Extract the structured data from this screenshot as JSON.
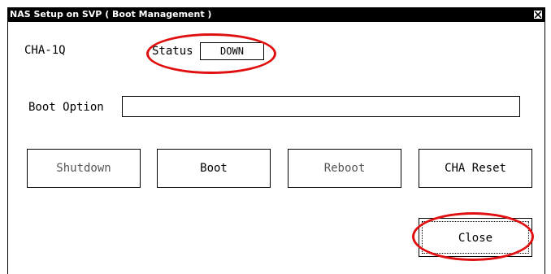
{
  "window": {
    "title": "NAS Setup on SVP ( Boot Management )"
  },
  "cha": {
    "id_label": "CHA-1Q",
    "status_label": "Status",
    "status_value": "DOWN"
  },
  "boot_option": {
    "label": "Boot Option",
    "value": ""
  },
  "buttons": {
    "shutdown": "Shutdown",
    "boot": "Boot",
    "reboot": "Reboot",
    "cha_reset": "CHA Reset",
    "close": "Close"
  },
  "colors": {
    "annotation_circle": "#e01010",
    "titlebar_bg": "#000000"
  },
  "icons": {
    "window_close": "close-icon"
  }
}
